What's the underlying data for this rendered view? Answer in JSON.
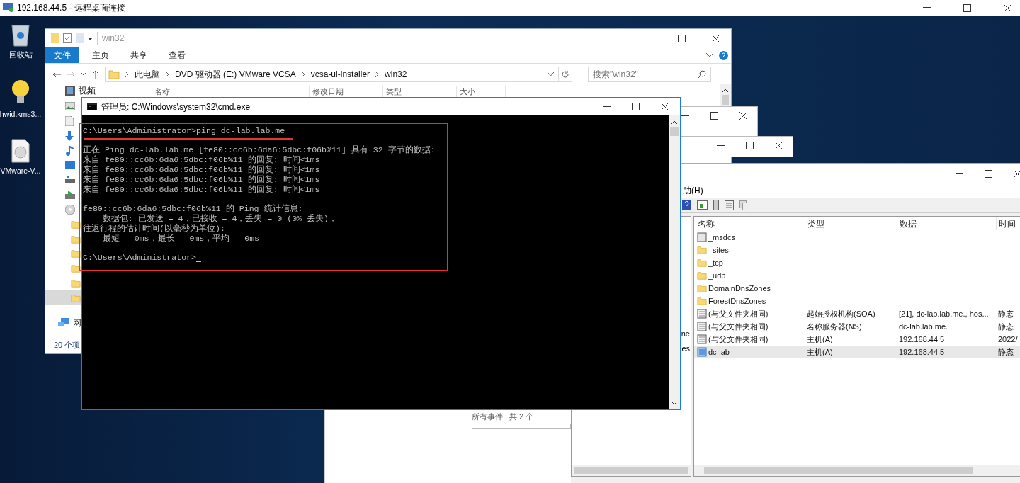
{
  "rdp_window": {
    "title": "192.168.44.5 - 远程桌面连接"
  },
  "desktop_icons": [
    {
      "kind": "recycle_bin",
      "label": "回收站"
    },
    {
      "kind": "bulb",
      "label": "hwid.kms3..."
    },
    {
      "kind": "disc",
      "label": "VMware-V..."
    }
  ],
  "dns_window": {
    "menu": "助(H)",
    "tree_fragments": [
      "ne",
      "es"
    ],
    "columns": [
      "名称",
      "类型",
      "数据",
      "时间"
    ],
    "rows": [
      {
        "kind": "delegation",
        "name": "_msdcs",
        "selected": false
      },
      {
        "kind": "folder",
        "name": "_sites",
        "selected": false
      },
      {
        "kind": "folder",
        "name": "_tcp",
        "selected": false
      },
      {
        "kind": "folder",
        "name": "_udp",
        "selected": false
      },
      {
        "kind": "folder",
        "name": "DomainDnsZones",
        "selected": false
      },
      {
        "kind": "folder",
        "name": "ForestDnsZones",
        "selected": false
      },
      {
        "kind": "record",
        "name": "(与父文件夹相同)",
        "type": "起始授权机构(SOA)",
        "data": "[21], dc-lab.lab.me., hos...",
        "timestamp": "静态",
        "selected": false
      },
      {
        "kind": "record",
        "name": "(与父文件夹相同)",
        "type": "名称服务器(NS)",
        "data": "dc-lab.lab.me.",
        "timestamp": "静态",
        "selected": false
      },
      {
        "kind": "record",
        "name": "(与父文件夹相同)",
        "type": "主机(A)",
        "data": "192.168.44.5",
        "timestamp": "2022/",
        "selected": false
      },
      {
        "kind": "host",
        "name": "dc-lab",
        "type": "主机(A)",
        "data": "192.168.44.5",
        "timestamp": "静态",
        "selected": true
      }
    ]
  },
  "events_window": {
    "status": "所有事件 | 共 2 个"
  },
  "explorer": {
    "title": "win32",
    "ribbon_tabs": [
      {
        "label": "文件",
        "selected": true
      },
      {
        "label": "主页",
        "selected": false
      },
      {
        "label": "共享",
        "selected": false
      },
      {
        "label": "查看",
        "selected": false
      }
    ],
    "breadcrumbs": [
      "此电脑",
      "DVD 驱动器 (E:) VMware VCSA",
      "vcsa-ui-installer",
      "win32"
    ],
    "search": {
      "placeholder": "搜索\"win32\""
    },
    "columns": [
      "名称",
      "修改日期",
      "类型",
      "大小"
    ],
    "sidebar": [
      {
        "kind": "video",
        "label": "视频",
        "selected": false
      },
      {
        "kind": "pictures",
        "selected": false
      },
      {
        "kind": "documents",
        "selected": false
      },
      {
        "kind": "downloads",
        "selected": false
      },
      {
        "kind": "music",
        "selected": false
      },
      {
        "kind": "desktop",
        "selected": false
      },
      {
        "kind": "drive",
        "selected": false
      },
      {
        "kind": "drive_sync",
        "selected": false
      },
      {
        "kind": "dvd",
        "selected": false
      },
      {
        "kind": "folder",
        "selected": false
      },
      {
        "kind": "folder",
        "selected": false
      },
      {
        "kind": "folder",
        "selected": false
      },
      {
        "kind": "folder",
        "selected": false
      },
      {
        "kind": "folder",
        "selected": false
      },
      {
        "kind": "folder",
        "selected": true
      },
      {
        "kind": "network",
        "label": "网",
        "selected": false
      }
    ],
    "status": "20 个项"
  },
  "cmd": {
    "title": "管理员: C:\\Windows\\system32\\cmd.exe",
    "blocks": [
      [
        "C:\\Users\\Administrator>ping dc-lab.lab.me"
      ],
      [
        "正在 Ping dc-lab.lab.me [fe80::cc6b:6da6:5dbc:f06b%11] 具有 32 字节的数据:",
        "来自 fe80::cc6b:6da6:5dbc:f06b%11 的回复: 时间<1ms",
        "来自 fe80::cc6b:6da6:5dbc:f06b%11 的回复: 时间<1ms",
        "来自 fe80::cc6b:6da6:5dbc:f06b%11 的回复: 时间<1ms",
        "来自 fe80::cc6b:6da6:5dbc:f06b%11 的回复: 时间<1ms"
      ],
      [
        "fe80::cc6b:6da6:5dbc:f06b%11 的 Ping 统计信息:",
        "    数据包: 已发送 = 4，已接收 = 4，丢失 = 0 (0% 丢失)，",
        "往返行程的估计时间(以毫秒为单位):",
        "    最短 = 0ms，最长 = 0ms，平均 = 0ms"
      ],
      [
        "C:\\Users\\Administrator>"
      ]
    ]
  }
}
